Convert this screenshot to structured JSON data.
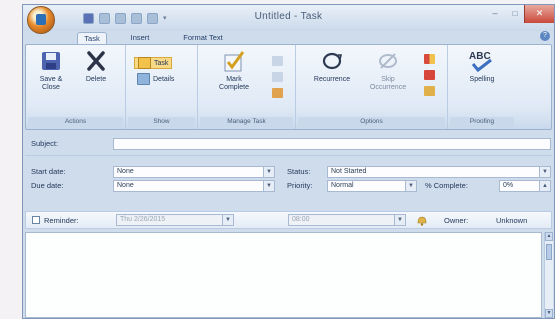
{
  "window": {
    "title": "Untitled - Task"
  },
  "title_controls": {
    "minimize": "–",
    "maximize": "□",
    "close": "✕"
  },
  "tabs": [
    {
      "label": "Task",
      "active": true
    },
    {
      "label": "Insert",
      "active": false
    },
    {
      "label": "Format Text",
      "active": false
    }
  ],
  "help_glyph": "?",
  "ribbon": {
    "actions": {
      "save_close": "Save &\nClose",
      "delete": "Delete",
      "group": "Actions"
    },
    "show": {
      "task": "Task",
      "details": "Details",
      "group": "Show"
    },
    "manage": {
      "mark_complete": "Mark\nComplete",
      "group": "Manage Task"
    },
    "options": {
      "recurrence": "Recurrence",
      "skip": "Skip\nOccurrence",
      "group": "Options"
    },
    "proofing": {
      "spelling": "Spelling",
      "group": "Proofing"
    }
  },
  "form": {
    "subject_label": "Subject:",
    "subject_value": "",
    "start_label": "Start date:",
    "start_value": "None",
    "due_label": "Due date:",
    "due_value": "None",
    "status_label": "Status:",
    "status_value": "Not Started",
    "priority_label": "Priority:",
    "priority_value": "Normal",
    "complete_label": "% Complete:",
    "complete_value": "0%",
    "reminder_label": "Reminder:",
    "reminder_date": "Thu 2/26/2015",
    "reminder_time": "08:00",
    "owner_label": "Owner:",
    "owner_value": "Unknown"
  },
  "colors": {
    "accent": "#2c6fb7",
    "close_button": "#c8493a",
    "orb": "#e88a2a"
  },
  "icons": {
    "orb": "office-orb-icon",
    "save_close": "save-icon",
    "delete": "delete-x-icon",
    "task": "task-icon",
    "details": "details-icon",
    "mark_complete": "checkmark-icon",
    "recurrence": "recurrence-icon",
    "skip": "skip-occurrence-icon",
    "spelling": "spelling-abc-icon",
    "bell": "reminder-bell-icon"
  }
}
